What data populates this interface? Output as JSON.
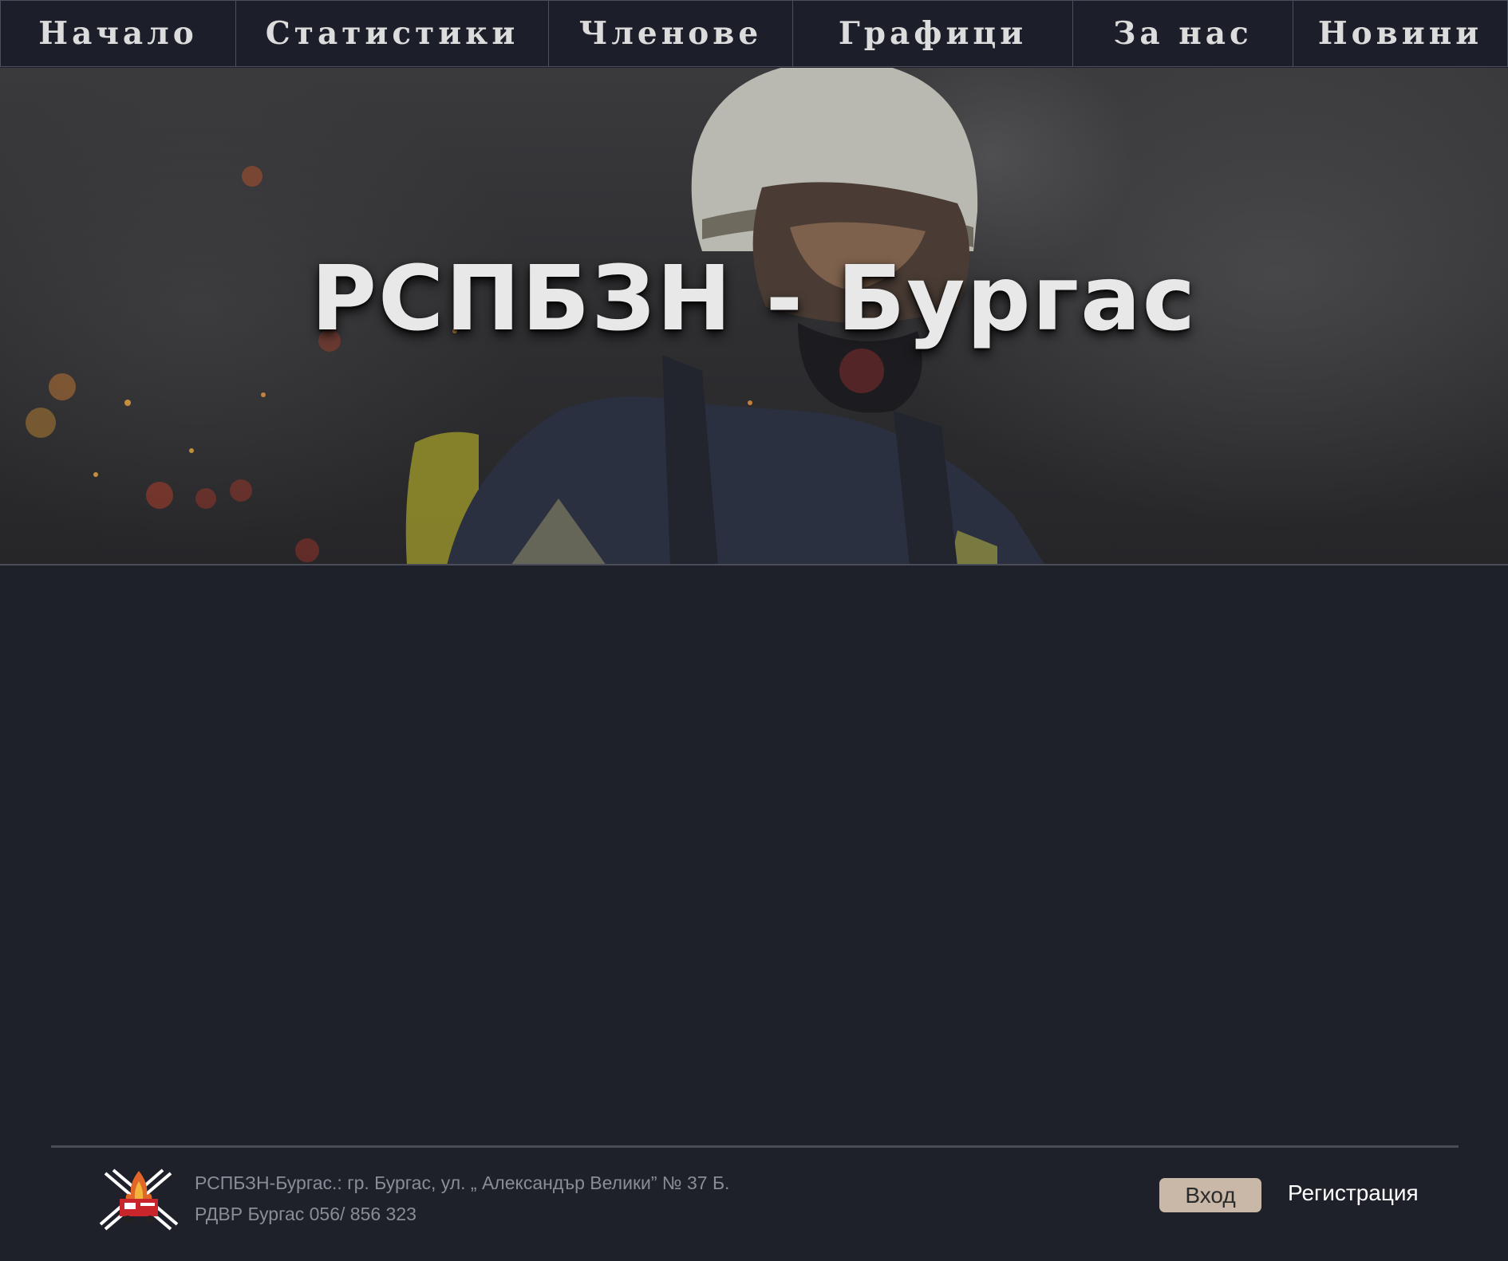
{
  "nav": {
    "items": [
      {
        "label": "Начало"
      },
      {
        "label": "Статистики"
      },
      {
        "label": "Членове"
      },
      {
        "label": "Графици"
      },
      {
        "label": "За нас"
      },
      {
        "label": "Новини"
      }
    ]
  },
  "hero": {
    "title": "РСПБЗН - Бургас",
    "image": "firefighter-in-helmet-and-mask"
  },
  "footer": {
    "logo": "fire-department-logo",
    "address": "РСПБЗН-Бургас.: гр. Бургас, ул. „ Александър Велики” № 37 Б.",
    "phone": "РДВР Бургас 056/ 856 323",
    "login_label": "Вход",
    "register_label": "Регистрация"
  },
  "colors": {
    "background": "#1e202a",
    "nav_background": "#1c1f2a",
    "login_button": "#c9b8a7"
  }
}
